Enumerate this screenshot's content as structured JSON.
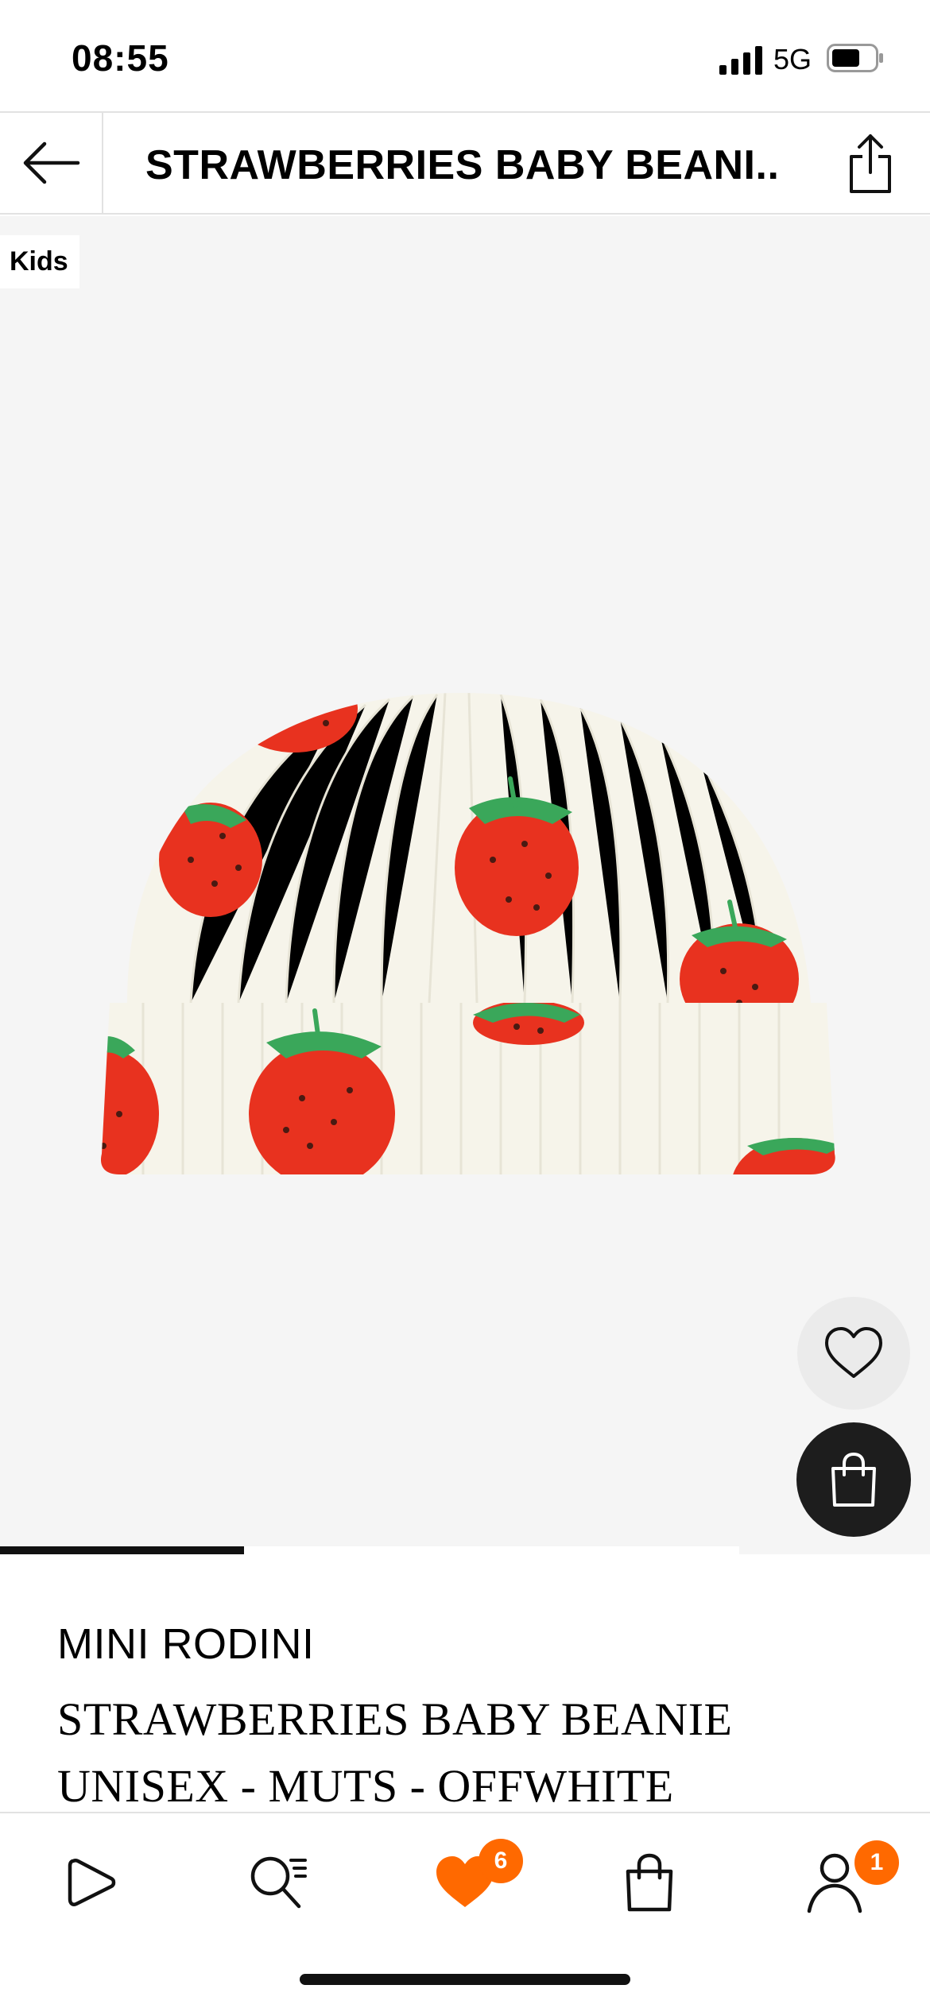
{
  "status_bar": {
    "time": "08:55",
    "network": "5G"
  },
  "header": {
    "title": "STRAWBERRIES BABY BEANI..."
  },
  "gallery": {
    "tag": "Kids",
    "image_description_icon": "strawberry-beanie-image",
    "carousel_progress_fraction": 0.33
  },
  "product": {
    "brand": "MINI RODINI",
    "name_line1": "STRAWBERRIES BABY BEANIE",
    "name_line2": "UNISEX - MUTS - OFFWHITE"
  },
  "bottom_nav": {
    "wishlist_count": "6",
    "account_count": "1"
  },
  "colors": {
    "accent": "#ff6900",
    "image_bg": "#f5f5f5",
    "bag_button": "#1d1d1d",
    "strawberry": "#e8321f",
    "leaf": "#3aa75a",
    "beanie": "#f6f4ea"
  }
}
